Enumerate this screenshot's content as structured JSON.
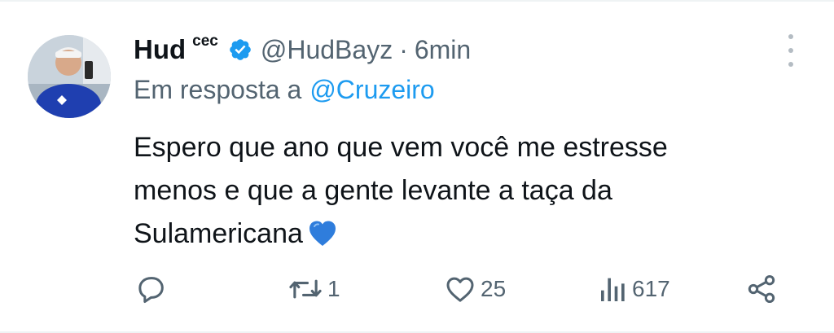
{
  "tweet": {
    "author_name": "Hud",
    "author_suffix": "cec",
    "handle": "@HudBayz",
    "separator": "·",
    "time": "6min",
    "reply_prefix": "Em resposta a",
    "reply_mention": "@Cruzeiro",
    "text_lines": [
      "Espero que ano que vem você me estresse",
      "menos e que a gente levante a taça da",
      "Sulamericana"
    ],
    "emoji": "blue-heart"
  },
  "actions": {
    "reply_count": "",
    "retweet_count": "1",
    "like_count": "25",
    "views_count": "617"
  },
  "colors": {
    "text": "#0f1419",
    "secondary": "#536471",
    "accent": "#1d9bf0",
    "verified": "#1d9bf0",
    "border": "#eff3f4"
  }
}
